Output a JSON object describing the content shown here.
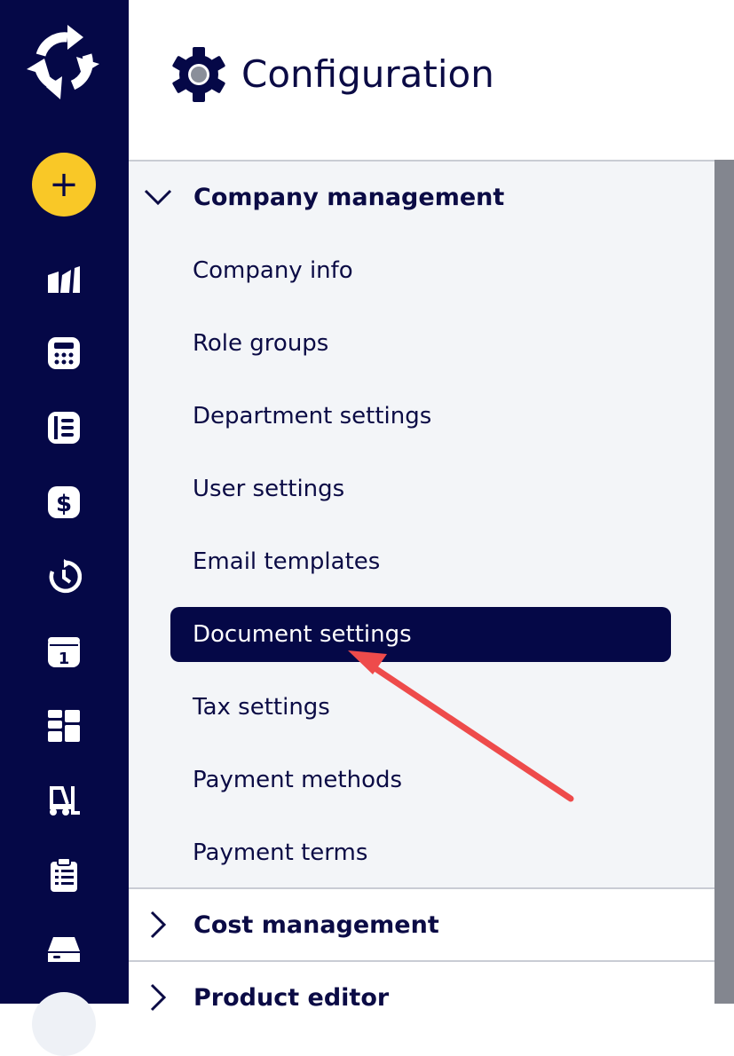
{
  "rail": {
    "logo": "circular-arrows-logo",
    "add_label": "+",
    "icons": [
      "factory-icon",
      "calculator-icon",
      "book-icon",
      "dollar-icon",
      "history-icon",
      "calendar-icon",
      "grid-icon",
      "forklift-icon",
      "clipboard-icon",
      "inbox-icon"
    ]
  },
  "header": {
    "icon": "gear-icon",
    "title": "Configuration"
  },
  "menu": {
    "sections": [
      {
        "label": "Company management",
        "expanded": true,
        "items": [
          "Company info",
          "Role groups",
          "Department settings",
          "User settings",
          "Email templates",
          "Document settings",
          "Tax settings",
          "Payment methods",
          "Payment terms"
        ],
        "active_item": "Document settings"
      },
      {
        "label": "Cost management",
        "expanded": false
      },
      {
        "label": "Product editor",
        "expanded": false
      }
    ]
  },
  "colors": {
    "rail_bg": "#050847",
    "accent_yellow": "#f9c827",
    "active_bg": "#050847",
    "panel_bg": "#f3f5f8",
    "annotation_arrow": "#ee4b4b"
  }
}
